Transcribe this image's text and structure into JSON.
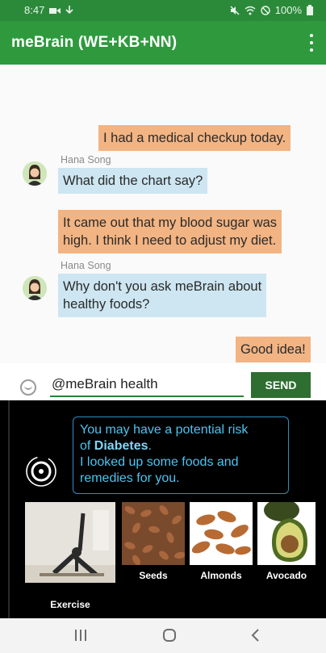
{
  "status_bar": {
    "time": "8:47",
    "battery": "100%"
  },
  "app_bar": {
    "title": "meBrain (WE+KB+NN)"
  },
  "chat": {
    "messages": [
      {
        "direction": "out",
        "text": "I had a medical checkup today."
      },
      {
        "direction": "in",
        "sender": "Hana Song",
        "text": "What did the chart say?"
      },
      {
        "direction": "out",
        "line1": "It came out that my blood sugar was",
        "line2": "high. I think I need to adjust my diet."
      },
      {
        "direction": "in",
        "sender": "Hana Song",
        "line1": "Why don't you ask meBrain about",
        "line2": "healthy foods?"
      },
      {
        "direction": "out",
        "text": "Good idea!"
      }
    ]
  },
  "compose": {
    "input_value": "@meBrain health",
    "send_label": "SEND"
  },
  "mebrain": {
    "line1": "You may have a potential risk",
    "line2_prefix": "of ",
    "line2_bold": "Diabetes",
    "line2_suffix": ".",
    "line3": "I looked up some foods and",
    "line4": "remedies for you.",
    "tiles": [
      {
        "label": "Exercise"
      },
      {
        "label": "Seeds"
      },
      {
        "label": "Almonds"
      },
      {
        "label": "Avocado"
      }
    ]
  },
  "colors": {
    "status_bar": "#2b8a3a",
    "app_bar": "#2e9a3d",
    "outgoing_bubble": "#f2b483",
    "incoming_bubble": "#cde6f1",
    "send_button": "#2e6e30",
    "info_text": "#4ec3ee",
    "info_border": "#2f8fc2"
  },
  "icons": {
    "status_left": [
      "video-call-icon",
      "download-icon"
    ],
    "status_right": [
      "mute-icon",
      "wifi-icon",
      "dnd-icon",
      "battery-icon"
    ],
    "nav": [
      "recents-icon",
      "home-icon",
      "back-icon"
    ]
  }
}
